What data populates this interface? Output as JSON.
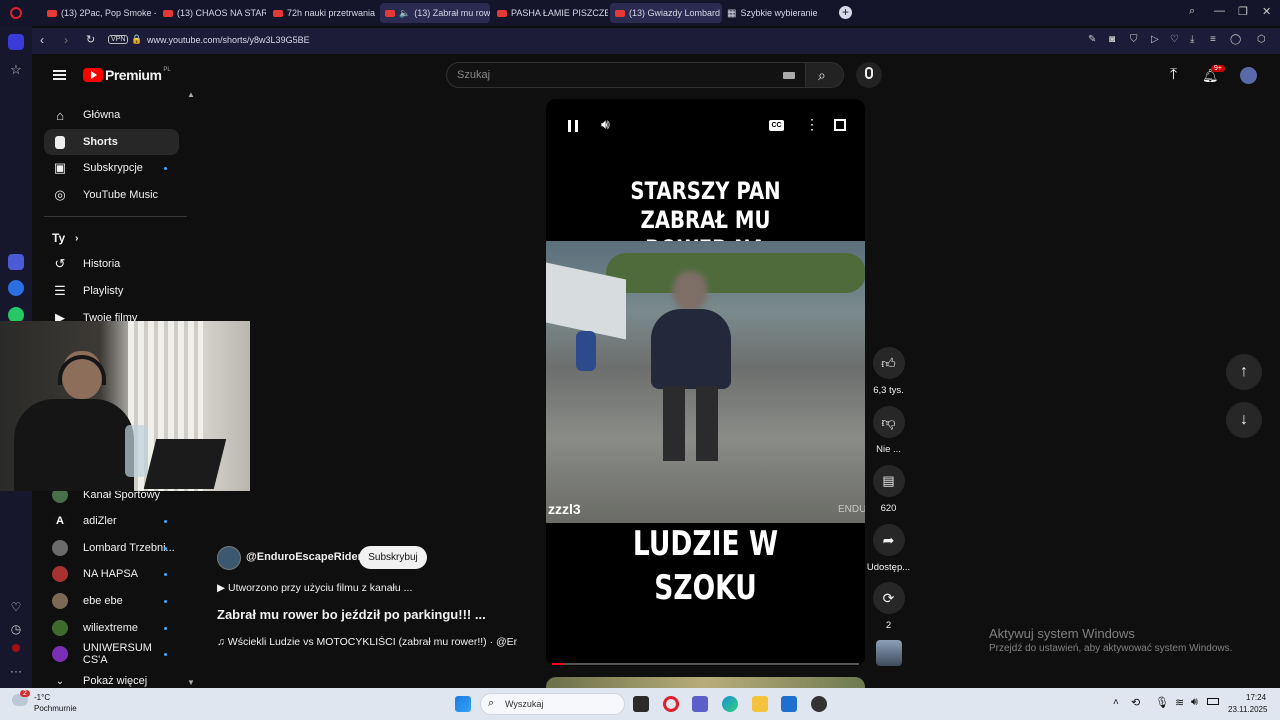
{
  "browser": {
    "tabs": [
      {
        "label": "(13) 2Pac, Pop Smoke - W"
      },
      {
        "label": "(13) CHAOS NA STARCIE, "
      },
      {
        "label": "72h nauki przetrwania - cz"
      },
      {
        "label": "(13) Zabrał mu rower"
      },
      {
        "label": "PASHA ŁAMIE PISZCZEL! 🩼"
      },
      {
        "label": "(13) Gwiazdy Lombard"
      },
      {
        "label": "Szybkie wybieranie"
      }
    ],
    "vpn_label": "VPN",
    "url": "www.youtube.com/shorts/y8w3L39G5BE"
  },
  "youtube": {
    "logo_text": "Premium",
    "logo_region": "PL",
    "search_placeholder": "Szukaj",
    "notification_count": "9+",
    "nav": {
      "main": [
        {
          "label": "Główna",
          "icon": "home-icon"
        },
        {
          "label": "Shorts",
          "icon": "shorts-icon"
        },
        {
          "label": "Subskrypcje",
          "icon": "subscriptions-icon"
        },
        {
          "label": "YouTube Music",
          "icon": "music-icon"
        }
      ],
      "you_header": "Ty",
      "you_items": [
        {
          "label": "Historia",
          "icon": "history-icon"
        },
        {
          "label": "Playlisty",
          "icon": "playlist-icon"
        },
        {
          "label": "Twoje filmy",
          "icon": "your-videos-icon"
        }
      ],
      "subscriptions": [
        {
          "label": "Kanał Sportowy",
          "color": "#4a6d4a"
        },
        {
          "label": "adiZler",
          "color": "#111111"
        },
        {
          "label": "Lombard Trzebni...",
          "color": "#6b6b6b"
        },
        {
          "label": "NA HAPSA",
          "color": "#a83232"
        },
        {
          "label": "ebe ebe",
          "color": "#7a6a55"
        },
        {
          "label": "wiliextreme",
          "color": "#3e6b2c"
        },
        {
          "label": "UNIWERSUM CS'A",
          "color": "#7b2fb5"
        }
      ],
      "show_more": "Pokaż więcej"
    },
    "short": {
      "caption_top": "STARSZY PAN ZABRAŁ MU ROWER NA POLICJĘ",
      "caption_bottom": "LUDZIE W SZOKU",
      "watermark_left": "zzzl3",
      "watermark_right": "ENDU",
      "channel": "@EnduroEscapeRiders",
      "subscribe_label": "Subskrybuj",
      "created_with": "▶ Utworzono przy użyciu filmu z kanału ...",
      "title": "Zabrał mu rower bo jeździł po parkingu!!! ...",
      "sound": "♫ Wściekli Ludzie vs MOTOCYKLIŚCI (zabrał mu rower!!) · @En",
      "progress": 0.04
    },
    "actions": {
      "likes": "6,3 tys.",
      "dislike": "Nie ...",
      "comments": "620",
      "share": "Udostęp...",
      "remix": "2"
    }
  },
  "windows": {
    "activate_title": "Aktywuj system Windows",
    "activate_sub": "Przejdź do ustawień, aby aktywować system Windows.",
    "weather_temp": "-1°C",
    "weather_desc": "Pochmurnie",
    "weather_badge": "2",
    "search_placeholder": "Wyszukaj",
    "time": "17:24",
    "date": "23.11.2025"
  },
  "colors": {
    "yt_red": "#ff0000",
    "accent_blue": "#3ea6ff",
    "tab_bg": "#14142a"
  }
}
